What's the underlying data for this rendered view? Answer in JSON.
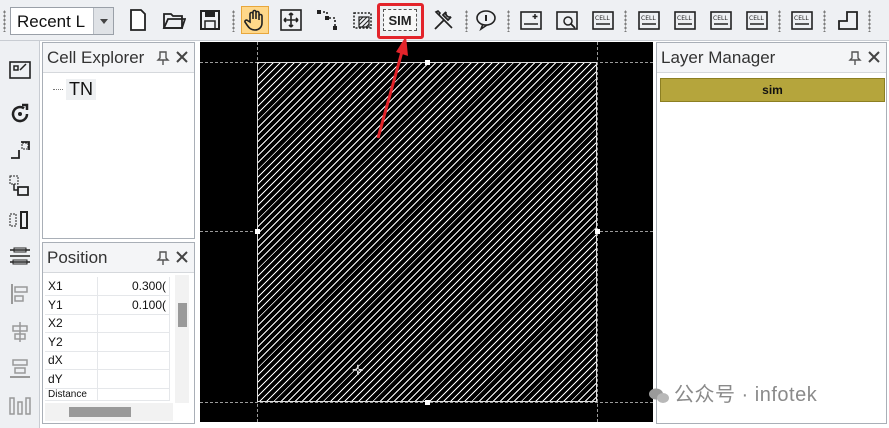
{
  "toolbar": {
    "recent_value": "Recent L",
    "sim_label": "SIM"
  },
  "cell_explorer": {
    "title": "Cell Explorer",
    "tree": [
      {
        "label": "TN"
      }
    ]
  },
  "position": {
    "title": "Position",
    "rows": [
      {
        "label": "X1",
        "value": "0.300("
      },
      {
        "label": "Y1",
        "value": "0.100("
      },
      {
        "label": "X2",
        "value": ""
      },
      {
        "label": "Y2",
        "value": ""
      },
      {
        "label": "dX",
        "value": ""
      },
      {
        "label": "dY",
        "value": ""
      },
      {
        "label": "Distance",
        "value": ""
      }
    ]
  },
  "layer_manager": {
    "title": "Layer Manager",
    "layers": [
      {
        "name": "sim",
        "color": "#b5a53c"
      }
    ]
  },
  "watermark": "公众号 · infotek",
  "colors": {
    "highlight": "#e3242b",
    "active_tool": "#ffd88a",
    "canvas_bg": "#000000"
  }
}
